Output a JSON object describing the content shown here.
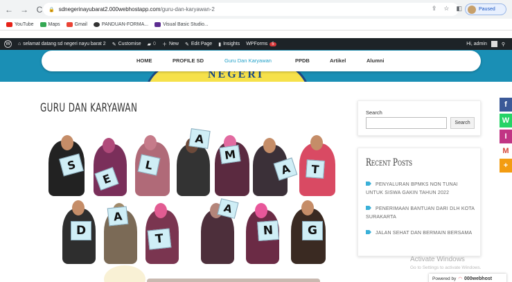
{
  "browser": {
    "url_host": "sdnegerinayubarat2.000webhostapp.com",
    "url_path": "/guru-dan-karyawan-2",
    "profile_status": "Paused"
  },
  "bookmarks": [
    "YouTube",
    "Maps",
    "Gmail",
    "PANDUAN-FORMA...",
    "Visual Basic Studio..."
  ],
  "wp_admin": {
    "site": "selamat datang sd negeri nayu barat 2",
    "customise": "Customise",
    "comments": "0",
    "new": "New",
    "edit_page": "Edit Page",
    "insights": "Insights",
    "wpforms": "WPForms",
    "wpforms_badge": "5",
    "greeting": "Hi, admin"
  },
  "banner_text": "NEGERI",
  "menu": [
    "HOME",
    "PROFILE SD",
    "Guru Dan Karyawan",
    "PPDB",
    "Artikel",
    "Alumni"
  ],
  "page_title": "GURU DAN KARYAWAN",
  "photo_letters": [
    "S",
    "E",
    "L",
    "A",
    "M",
    "A",
    "T",
    "D",
    "A",
    "T",
    "A",
    "N",
    "G"
  ],
  "sidebar": {
    "search_label": "Search",
    "search_button": "Search",
    "recent_title": "Recent Posts",
    "posts": [
      "PENYALURAN BPMKS NON TUNAI UNTUK SISWA GAKIN TAHUN 2022",
      "PENERIMAAN BANTUAN DARI DLH KOTA SURAKARTA",
      "JALAN SEHAT DAN BERMAIN BERSAMA"
    ]
  },
  "social": [
    "f",
    "W",
    "I",
    "M",
    "+"
  ],
  "activate": {
    "line1": "Activate Windows",
    "line2": "Go to Settings to activate Windows."
  },
  "powered": {
    "label": "Powered by",
    "brand": "000webhost"
  },
  "colors": {
    "banner": "#1a8fb5",
    "accent": "#20a0c8",
    "wpbar": "#1d2327"
  }
}
